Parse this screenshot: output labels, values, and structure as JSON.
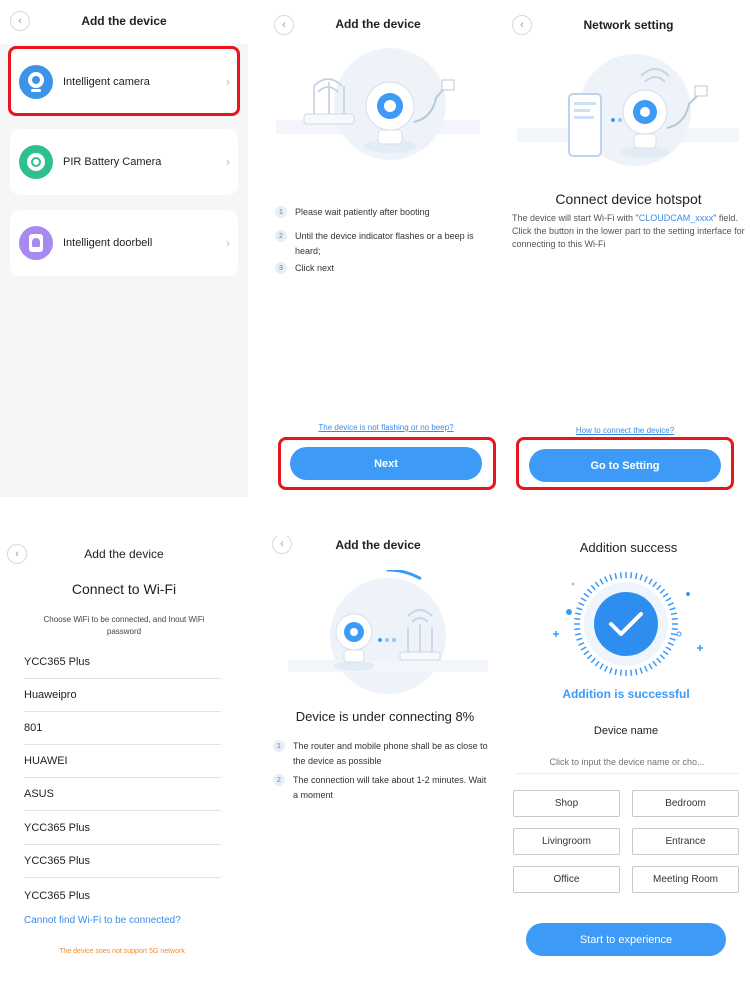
{
  "panel1": {
    "title": "Add the device",
    "items": [
      {
        "label": "Intelligent camera"
      },
      {
        "label": "PIR Battery Camera"
      },
      {
        "label": "Intelligent doorbell"
      }
    ]
  },
  "panel2": {
    "title": "Add the device",
    "steps": [
      {
        "num": "1",
        "text": "Please wait patiently after booting"
      },
      {
        "num": "2",
        "text": "Until the device indicator flashes or a beep is heard;"
      },
      {
        "num": "3",
        "text": "Click next"
      }
    ],
    "link": "The device is not flashing or no beep?",
    "button": "Next"
  },
  "panel3": {
    "title": "Network setting",
    "heading": "Connect device hotspot",
    "desc_before": "The device will start Wi-Fi with \"",
    "desc_ssid": "CLOUDCAM_xxxx",
    "desc_after": "\" field. Click the button in the lower part to the setting interface for connecting to this Wi-Fi",
    "link": "How to connect the device?",
    "button": "Go to Setting"
  },
  "panel4": {
    "title": "Add the device",
    "heading": "Connect to Wi-Fi",
    "subtitle": "Choose WiFi to be connected, and Inout WiFi password",
    "networks": [
      "YCC365 Plus",
      "Huaweipro",
      "801",
      "HUAWEI",
      "ASUS",
      "YCC365 Plus",
      "YCC365 Plus",
      "YCC365 Plus"
    ],
    "link": "Cannot find Wi-Fi to be connected?",
    "note": "The device soes not support 5G network"
  },
  "panel5": {
    "title": "Add the device",
    "status": "Device is under connecting 8%",
    "progress_percent": 8,
    "steps": [
      {
        "num": "1",
        "text": "The router and mobile phone shall be as close to the device as possible"
      },
      {
        "num": "2",
        "text": "The connection will take about 1-2 minutes. Wait a moment"
      }
    ]
  },
  "panel6": {
    "title": "Addition success",
    "success": "Addition is successful",
    "name_label": "Device name",
    "name_placeholder": "Click to input the device name or cho...",
    "rooms": [
      "Shop",
      "Bedroom",
      "Livingroom",
      "Entrance",
      "Office",
      "Meeting Room"
    ],
    "button": "Start to experience"
  },
  "colors": {
    "accent": "#3d9af6",
    "highlight_box": "#e8151d",
    "link": "#3a8be8",
    "warning": "#f08a2c"
  }
}
